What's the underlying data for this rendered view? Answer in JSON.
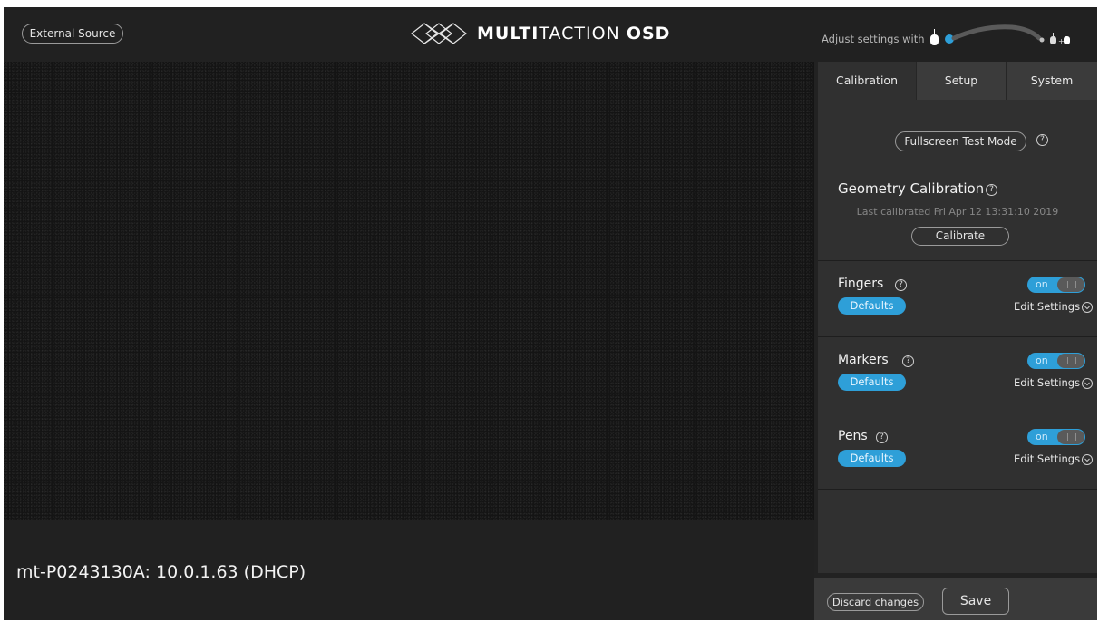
{
  "header": {
    "external_source_label": "External Source",
    "brand_bold": "MULTI",
    "brand_light": "TACTION",
    "brand_suffix": "OSD",
    "adjust_text": "Adjust settings with"
  },
  "device": {
    "info": "mt-P0243130A: 10.0.1.63 (DHCP)"
  },
  "tabs": [
    {
      "label": "Calibration"
    },
    {
      "label": "Setup"
    },
    {
      "label": "System"
    }
  ],
  "calibration": {
    "fullscreen_test_label": "Fullscreen Test Mode",
    "geometry_title": "Geometry Calibration",
    "last_calibrated": "Last calibrated Fri Apr 12 13:31:10 2019",
    "calibrate_label": "Calibrate",
    "help_glyph": "?"
  },
  "sections": [
    {
      "title": "Fingers",
      "defaults_label": "Defaults",
      "toggle_label": "on",
      "edit_label": "Edit Settings"
    },
    {
      "title": "Markers",
      "defaults_label": "Defaults",
      "toggle_label": "on",
      "edit_label": "Edit Settings"
    },
    {
      "title": "Pens",
      "defaults_label": "Defaults",
      "toggle_label": "on",
      "edit_label": "Edit Settings"
    }
  ],
  "footer": {
    "discard_label": "Discard changes",
    "save_label": "Save"
  },
  "colors": {
    "accent": "#2e9fd8",
    "background": "#222222",
    "panel": "#303030"
  },
  "icons": {
    "logo": "multitaction-logo-icon",
    "help": "help-icon",
    "chevron": "chevron-down-circle-icon",
    "mouse": "mouse-icon",
    "slider": "slider-icon"
  }
}
